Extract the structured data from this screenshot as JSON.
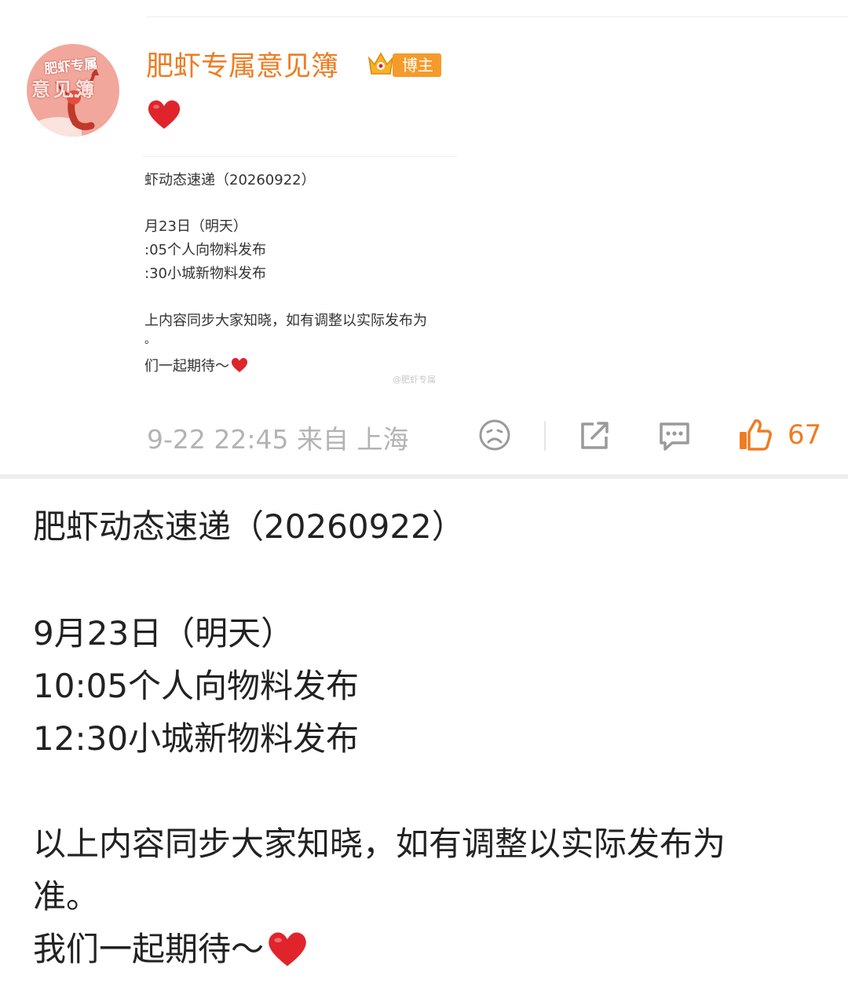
{
  "post": {
    "username": "肥虾专属意见簿",
    "badge": "博主",
    "avatar": {
      "line1": "肥虾专属",
      "line2": "意见簿"
    },
    "timestamp": "9-22 22:45",
    "source": "来自 上海",
    "like_count": "67",
    "watermark": "@肥虾专属",
    "thumbnail_lines": [
      "肥虾动态速递（20260922）",
      "9月23日（明天）",
      "10:05个人向物料发布",
      "12:30小城新物料发布",
      "以上内容同步大家知晓，如有调整以实际发布为",
      "准。",
      "我们一起期待～"
    ],
    "thumbnail_visible": [
      "虾动态速递（20260922）",
      "月23日（明天）",
      ":05个人向物料发布",
      ":30小城新物料发布",
      "上内容同步大家知晓，如有调整以实际发布为",
      "。",
      "们一起期待～"
    ]
  },
  "content": {
    "title": "肥虾动态速递（20260922）",
    "date_line": "9月23日（明天）",
    "item1": "10:05个人向物料发布",
    "item2": "12:30小城新物料发布",
    "notice_line1": "以上内容同步大家知晓，如有调整以实际发布为",
    "notice_line2": "准。",
    "closing": "我们一起期待～"
  },
  "icons": {
    "heart": "red-heart-emoji",
    "crown": "crown-badge-icon",
    "dislike": "sad-face-icon",
    "share": "share-icon",
    "comment": "comment-icon",
    "like": "thumbs-up-icon"
  },
  "colors": {
    "username": "#ef7c22",
    "badge": "#f59b2b",
    "heart": "#e0242c",
    "meta": "#b3b3b3",
    "like_active": "#ef7c22"
  }
}
